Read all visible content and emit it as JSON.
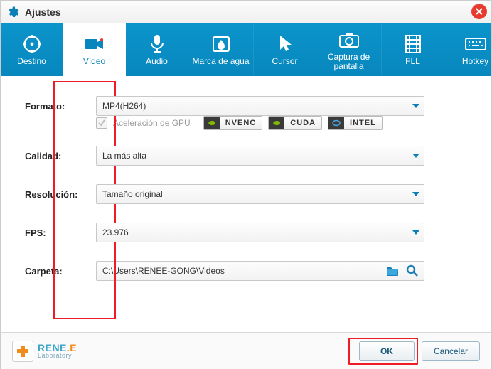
{
  "window": {
    "title": "Ajustes"
  },
  "tabs": {
    "items": [
      {
        "label": "Destino"
      },
      {
        "label": "Vídeo"
      },
      {
        "label": "Audio"
      },
      {
        "label": "Marca de agua"
      },
      {
        "label": "Cursor"
      },
      {
        "label": "Captura de pantalla"
      },
      {
        "label": "FLL"
      },
      {
        "label": "Hotkey"
      }
    ]
  },
  "video": {
    "format_label": "Formato:",
    "format_value": "MP4(H264)",
    "gpu_label": "Aceleración de GPU",
    "badge_nvenc": "NVENC",
    "badge_cuda": "CUDA",
    "badge_intel": "INTEL",
    "quality_label": "Calidad:",
    "quality_value": "La más alta",
    "resolution_label": "Resolución:",
    "resolution_value": "Tamaño original",
    "fps_label": "FPS:",
    "fps_value": "23.976",
    "folder_label": "Carpeta:",
    "folder_value": "C:\\Users\\RENEE-GONG\\Videos"
  },
  "footer": {
    "brand1a": "RENE",
    "brand1b": ".E",
    "brand2": "Laboratory",
    "ok": "OK",
    "cancel": "Cancelar"
  },
  "icons": {
    "destination": "target",
    "video": "camcorder",
    "audio": "microphone",
    "watermark": "droplet",
    "cursor": "pointer",
    "screenshot": "camera",
    "fll": "filmstrip",
    "hotkey": "keyboard"
  }
}
